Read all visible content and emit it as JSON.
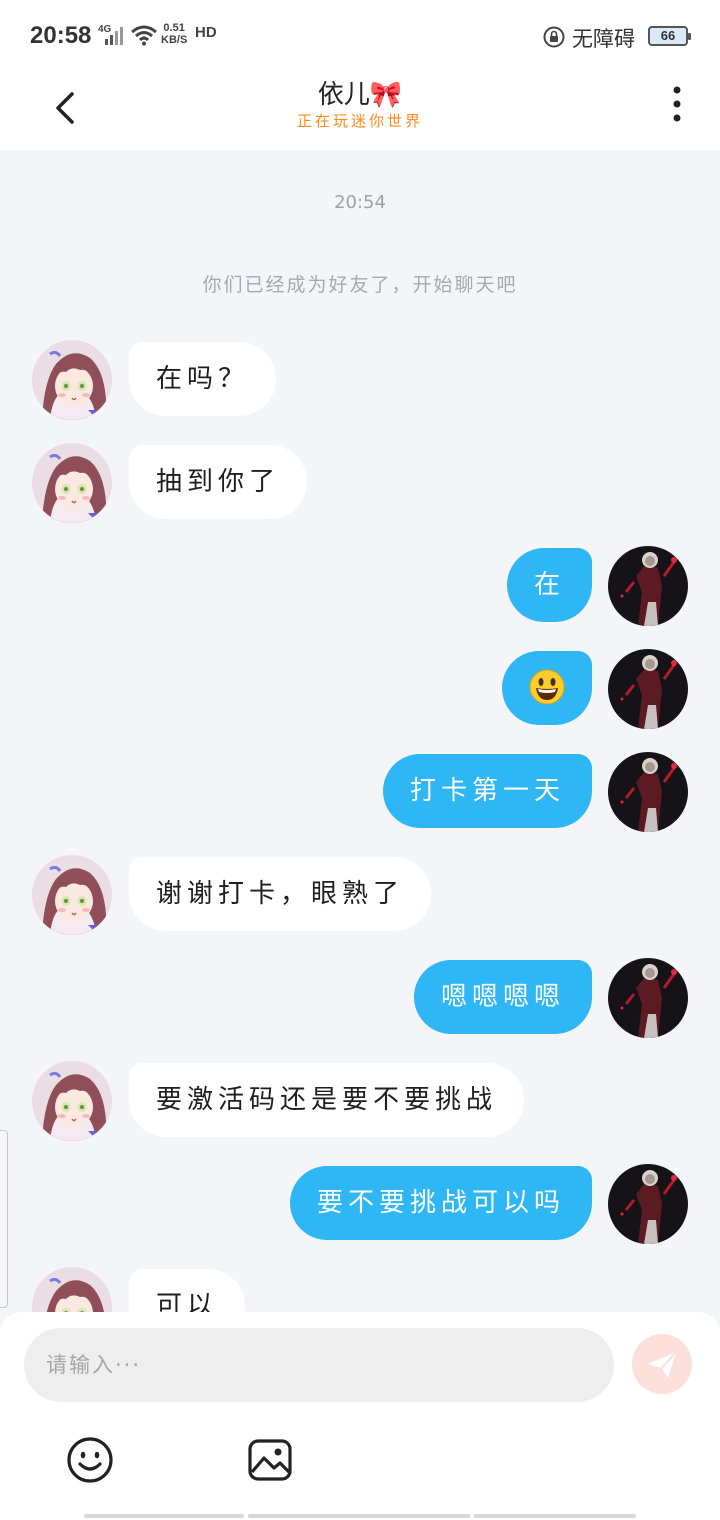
{
  "status_bar": {
    "time": "20:58",
    "network": "4G",
    "speed_value": "0.51",
    "speed_unit": "KB/S",
    "hd": "HD",
    "accessibility": "无障碍",
    "battery": "66"
  },
  "header": {
    "title": "依儿🎀",
    "subtitle": "正在玩迷你世界"
  },
  "chat": {
    "timestamp": "20:54",
    "system_notice": "你们已经成为好友了，开始聊天吧",
    "messages": [
      {
        "side": "left",
        "text": "在吗？"
      },
      {
        "side": "left",
        "text": "抽到你了"
      },
      {
        "side": "right",
        "text": "在"
      },
      {
        "side": "right",
        "text": "",
        "emoji": "grinning-face"
      },
      {
        "side": "right",
        "text": "打卡第一天"
      },
      {
        "side": "left",
        "text": "谢谢打卡，眼熟了"
      },
      {
        "side": "right",
        "text": "嗯嗯嗯嗯"
      },
      {
        "side": "left",
        "text": "要激活码还是要不要挑战"
      },
      {
        "side": "right",
        "text": "要不要挑战可以吗"
      },
      {
        "side": "left",
        "text": "可以"
      }
    ]
  },
  "composer": {
    "placeholder": "请输入···",
    "send_color": "#fde0dc"
  },
  "colors": {
    "outgoing_bubble": "#2fb6f5",
    "incoming_bubble": "#ffffff",
    "subtitle": "#ff8a1e"
  },
  "icons": {
    "back": "chevron-left-icon",
    "more": "more-vertical-icon",
    "send": "paper-plane-icon",
    "emoji": "smiley-icon",
    "image": "image-icon"
  }
}
